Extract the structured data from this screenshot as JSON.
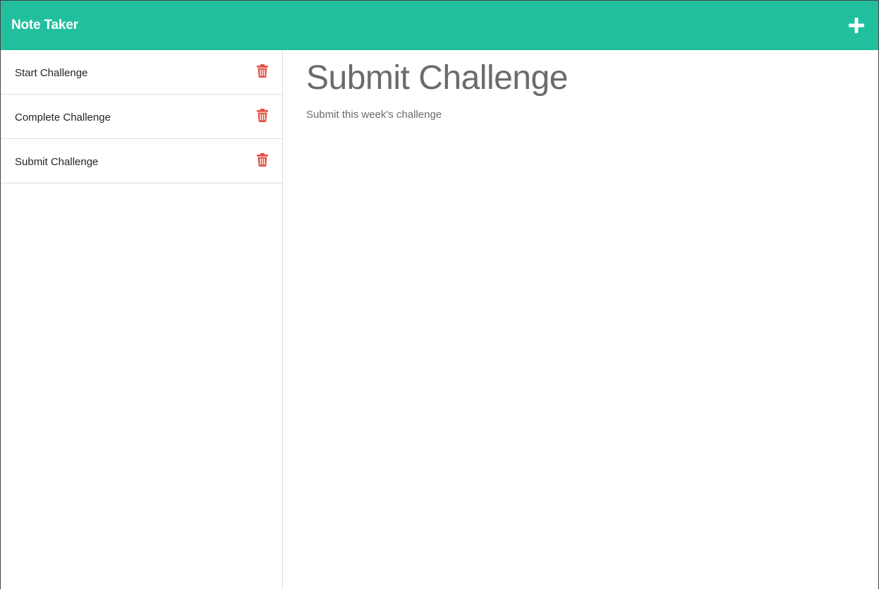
{
  "navbar": {
    "brand": "Note Taker",
    "add_icon": "plus-icon",
    "color": "#22bf9e"
  },
  "sidebar": {
    "notes": [
      {
        "title": "Start Challenge",
        "delete_icon": "trash-icon"
      },
      {
        "title": "Complete Challenge",
        "delete_icon": "trash-icon"
      },
      {
        "title": "Submit Challenge",
        "delete_icon": "trash-icon"
      }
    ],
    "delete_color": "#e74c3c"
  },
  "main": {
    "note_title": "Submit Challenge",
    "note_text": "Submit this week's challenge"
  }
}
